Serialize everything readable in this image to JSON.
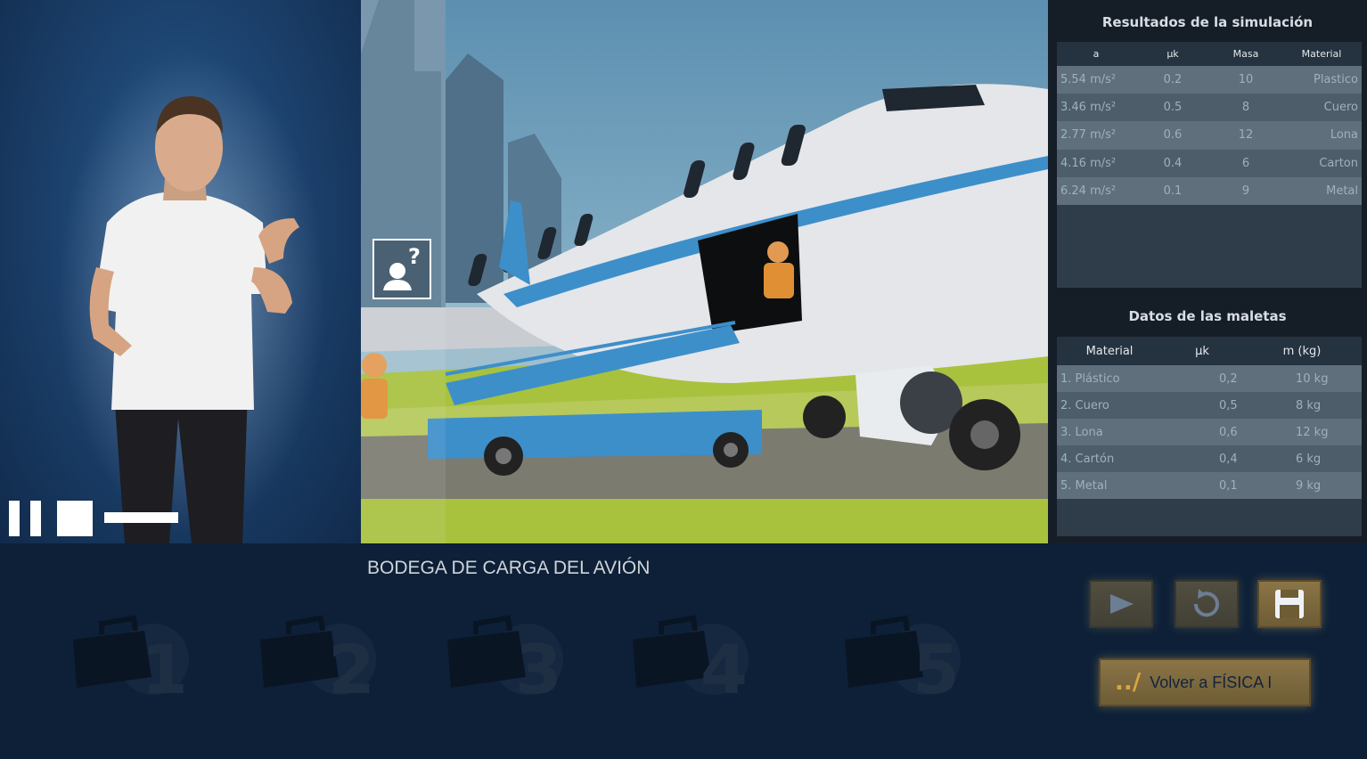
{
  "results": {
    "title": "Resultados de la simulación",
    "columns": [
      "a",
      "μk",
      "Masa",
      "Material"
    ],
    "rows": [
      {
        "a": "5.54 m/s²",
        "mu": "0.2",
        "masa": "10",
        "material": "Plastico"
      },
      {
        "a": "3.46 m/s²",
        "mu": "0.5",
        "masa": "8",
        "material": "Cuero"
      },
      {
        "a": "2.77 m/s²",
        "mu": "0.6",
        "masa": "12",
        "material": "Lona"
      },
      {
        "a": "4.16 m/s²",
        "mu": "0.4",
        "masa": "6",
        "material": "Carton"
      },
      {
        "a": "6.24 m/s²",
        "mu": "0.1",
        "masa": "9",
        "material": "Metal"
      }
    ]
  },
  "luggage": {
    "title": "Datos de las maletas",
    "columns": [
      "Material",
      "μk",
      "m (kg)"
    ],
    "rows": [
      {
        "material": "1. Plástico",
        "mu": "0,2",
        "m": "10 kg"
      },
      {
        "material": "2. Cuero",
        "mu": "0,5",
        "m": "8 kg"
      },
      {
        "material": "3. Lona",
        "mu": "0,6",
        "m": "12 kg"
      },
      {
        "material": "4. Cartón",
        "mu": "0,4",
        "m": "6 kg"
      },
      {
        "material": "5. Metal",
        "mu": "0,1",
        "m": "9 kg"
      }
    ]
  },
  "cargo": {
    "title": "BODEGA DE CARGA DEL AVIÓN",
    "suitcases": [
      "1",
      "2",
      "3",
      "4",
      "5"
    ]
  },
  "controls": {
    "play_icon": "play-icon",
    "reset_icon": "reset-icon",
    "save_icon": "save-icon",
    "back_prefix": "../",
    "back_label": "Volver a FÍSICA I"
  },
  "colors": {
    "gold": "#8a7547",
    "panel_dark": "#151d27",
    "row_light": "#5f6f7c",
    "row_dark": "#4d5d6a"
  }
}
